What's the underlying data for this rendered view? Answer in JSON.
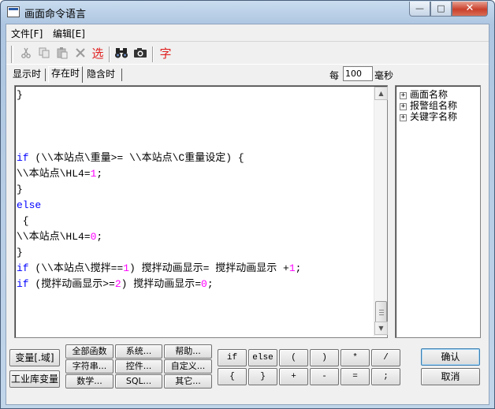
{
  "window": {
    "title": "画面命令语言",
    "min_label": "—",
    "max_label": "□",
    "close_label": "✕"
  },
  "menu": {
    "file": "文件[F]",
    "edit": "编辑[E]"
  },
  "toolbar": {
    "cut_icon": "scissors-icon",
    "copy_icon": "copy-icon",
    "paste_icon": "paste-icon",
    "delete_icon": "delete-icon",
    "select_label": "选",
    "find_icon": "binoculars-icon",
    "replace_icon": "camera-icon",
    "font_label": "字"
  },
  "tabs": [
    {
      "label": "显示时",
      "active": false
    },
    {
      "label": "存在时",
      "active": true
    },
    {
      "label": "隐含时",
      "active": false
    }
  ],
  "interval": {
    "prefix": "每",
    "value": "100",
    "unit": "毫秒"
  },
  "code_lines": [
    "}",
    "",
    "",
    "",
    "if (\\\\本站点\\重量>= \\\\本站点\\C重量设定) {",
    "\\\\本站点\\HL4=1;",
    "}",
    "else",
    " {",
    "\\\\本站点\\HL4=0;",
    "}",
    "if (\\\\本站点\\搅拌==1) 搅拌动画显示= 搅拌动画显示 +1;",
    "if (搅拌动画显示>=2) 搅拌动画显示=0;"
  ],
  "tree": {
    "items": [
      "画面名称",
      "报警组名称",
      "关键字名称"
    ],
    "expander": "+"
  },
  "buttons": {
    "variable": "变量[.域]",
    "industrial_var": "工业库变量",
    "all_functions": "全部函数",
    "system": "系统...",
    "help": "帮助...",
    "string": "字符串...",
    "control": "控件...",
    "custom": "自定义...",
    "math": "数学...",
    "sql": "SQL...",
    "other": "其它...",
    "confirm": "确认",
    "cancel": "取消"
  },
  "operators": {
    "row1": [
      "if",
      "else",
      "(",
      ")",
      "*",
      "/"
    ],
    "row2": [
      "{",
      "}",
      "+",
      "-",
      "=",
      ";"
    ]
  },
  "colors": {
    "keyword": "#0000ff",
    "number": "#ff00ff",
    "title_gradient": "#aec6e1",
    "close_button": "#c9402c"
  }
}
